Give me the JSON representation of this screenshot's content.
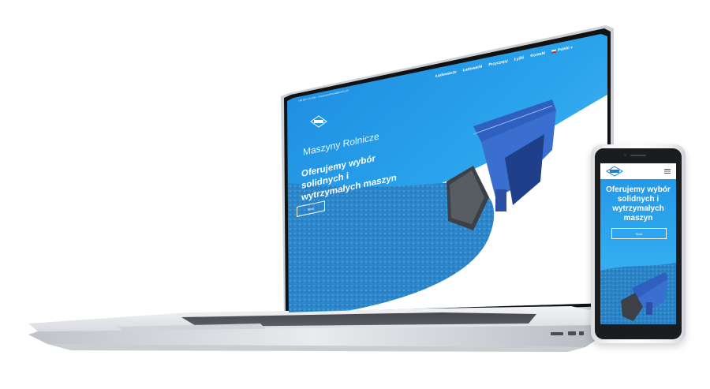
{
  "laptop_site": {
    "contact": "+48 602 123 456 · maszynyrolnicze@gmail.com",
    "nav": [
      "Ładowacze",
      "Ładowarki",
      "Przyczepy",
      "Łyżki",
      "Kontakt",
      "Polski"
    ],
    "language_caret": "∨",
    "title": "Maszyny Rolnicze",
    "headline": "Oferujemy wybór solidnych i wytrzymałych maszyn",
    "button": "Start"
  },
  "phone_site": {
    "headline": "Oferujemy wybór solidnych i wytrzymałych maszyn",
    "button": "Start"
  },
  "colors": {
    "sky": "#2ba6ee",
    "field": "#2a7fbf",
    "laptop_bezel": "#111214",
    "body_silver": "#e6e8eb"
  },
  "icons": [
    "logo-icon",
    "hamburger-menu-icon",
    "poland-flag-icon",
    "front-loader-image"
  ]
}
